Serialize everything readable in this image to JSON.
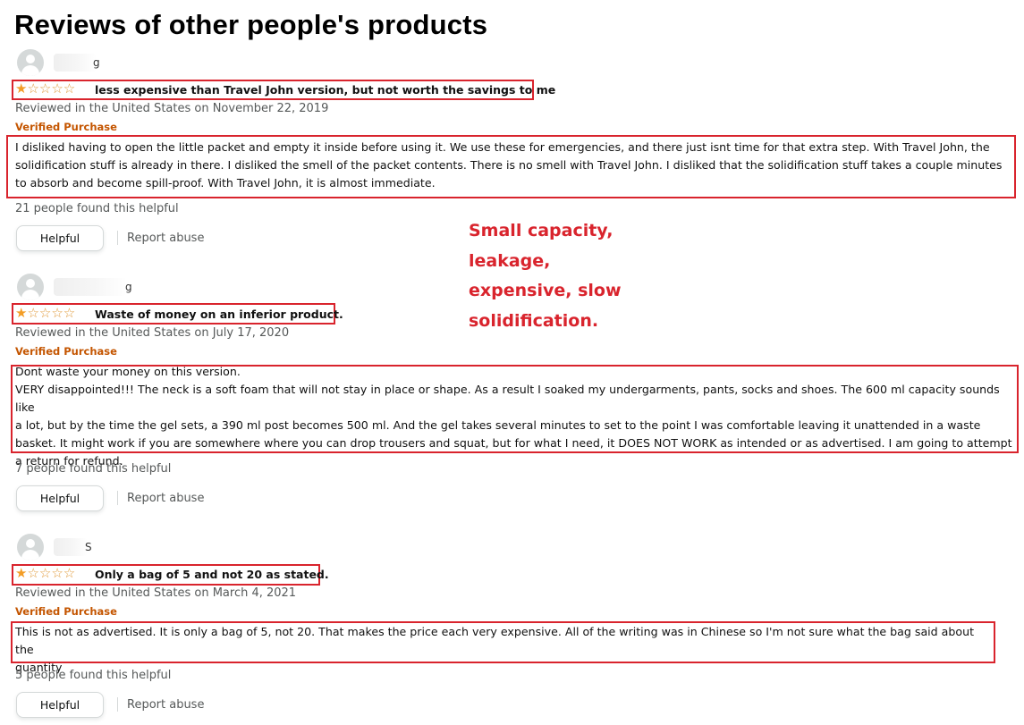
{
  "page": {
    "title": "Reviews of other people's products"
  },
  "annotation": {
    "lines": [
      "Small capacity,",
      "leakage,",
      "expensive, slow",
      "solidification."
    ],
    "color": "#d9242d"
  },
  "colors": {
    "star": "#f39d26",
    "verified": "#c45500",
    "highlight_box": "#d9242d",
    "meta_text": "#565959"
  },
  "reviews": [
    {
      "reviewer_name_visible": "g",
      "rating": 1,
      "rating_max": 5,
      "title": "less expensive than Travel John version, but not worth the savings to me",
      "date_line": "Reviewed in the United States on November 22, 2019",
      "verified": "Verified Purchase",
      "body_lines": [
        "I disliked having to open the little packet and empty it inside before using it. We use these for emergencies, and there just isnt time for that extra step. With Travel John, the",
        "solidification stuff is already in there. I disliked the smell of the packet contents. There is no smell with Travel John. I disliked that the solidification stuff takes a couple minutes",
        "to absorb and become spill-proof. With Travel John, it is almost immediate."
      ],
      "helpful_count": "21 people found this helpful",
      "helpful_button": "Helpful",
      "report_link": "Report abuse"
    },
    {
      "reviewer_name_visible": "g",
      "rating": 1,
      "rating_max": 5,
      "title": "Waste of money on an inferior product.",
      "date_line": "Reviewed in the United States on July 17, 2020",
      "verified": "Verified Purchase",
      "body_lines": [
        "Dont waste your money on this version.",
        "VERY disappointed!!! The neck is a soft foam that will not stay in place or shape. As a result I soaked my undergarments, pants, socks and shoes. The 600 ml capacity sounds like",
        "a lot, but by the time the gel sets, a 390 ml post becomes 500 ml. And the gel takes several minutes to set to the point I was comfortable leaving it unattended in a waste",
        "basket. It might work if you are somewhere where you can drop trousers and squat, but for what I need, it DOES NOT WORK as intended or as advertised. I am going to attempt",
        "a return for refund."
      ],
      "helpful_count": "7 people found this helpful",
      "helpful_button": "Helpful",
      "report_link": "Report abuse"
    },
    {
      "reviewer_name_visible": "S",
      "rating": 1,
      "rating_max": 5,
      "title": "Only a bag of 5 and not 20 as stated.",
      "date_line": "Reviewed in the United States on March 4, 2021",
      "verified": "Verified Purchase",
      "body_lines": [
        "This is not as advertised. It is only a bag of 5, not 20. That makes the price each very expensive. All of the writing was in Chinese so I'm not sure what the bag said about the",
        "quantity"
      ],
      "helpful_count": "5 people found this helpful",
      "helpful_button": "Helpful",
      "report_link": "Report abuse"
    }
  ]
}
